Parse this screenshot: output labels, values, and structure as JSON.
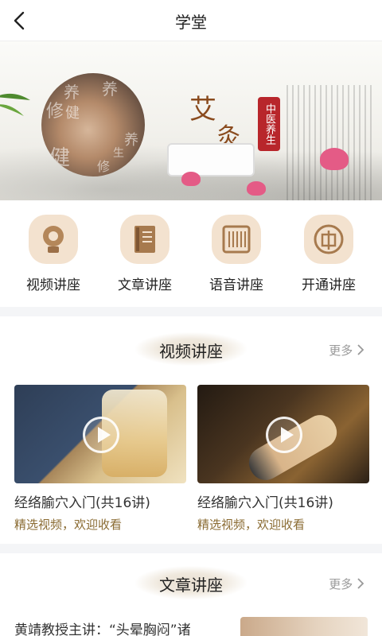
{
  "header": {
    "title": "学堂",
    "back_icon": "chevron-left-icon"
  },
  "banner": {
    "heading_line1": "艾",
    "heading_line2": "灸",
    "seal_text": "中医养生",
    "photo_glyphs": [
      "养",
      "健",
      "修",
      "养",
      "健",
      "修",
      "生",
      "养"
    ]
  },
  "quick_links": [
    {
      "label": "视频讲座",
      "icon": "speaker-icon"
    },
    {
      "label": "文章讲座",
      "icon": "book-icon"
    },
    {
      "label": "语音讲座",
      "icon": "audio-grid-icon"
    },
    {
      "label": "开通讲座",
      "icon": "seal-icon"
    }
  ],
  "video_section": {
    "title": "视频讲座",
    "more_label": "更多",
    "items": [
      {
        "title": "经络腧穴入门(共16讲)",
        "subtitle": "精选视频，欢迎收看"
      },
      {
        "title": "经络腧穴入门(共16讲)",
        "subtitle": "精选视频，欢迎收看"
      }
    ]
  },
  "article_section": {
    "title": "文章讲座",
    "more_label": "更多",
    "first_item_text": "黄靖教授主讲：“头晕胸闷”诸"
  },
  "colors": {
    "accent_brown": "#8a6b32",
    "seal_red": "#b8262b",
    "icon_bg": "#f3e2cf",
    "divider": "#f4f5f7"
  }
}
